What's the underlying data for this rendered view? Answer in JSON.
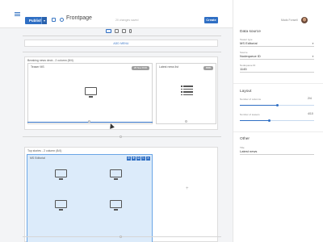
{
  "topbar": {
    "publish_label": "Publish",
    "page_name": "Frontpage",
    "changes_text": "20 changes saved",
    "create_label": "Create",
    "user_name": "Mads Fonsell"
  },
  "canvas": {
    "add_menu_label": "ADD MENU",
    "section1": {
      "label": "Breaking news deck - 2 column (8/4)",
      "module_a_label": "Teaser MS",
      "module_a_badge": "26 Nov 8:00",
      "module_b_label": "Latest news list",
      "module_b_badge": "BBB"
    },
    "section2": {
      "label": "Top stories - 2 column (8/4)",
      "module_label": "MS Editorial"
    }
  },
  "panel": {
    "data_source_title": "Data source",
    "teaser_type_label": "Teaser type",
    "teaser_type_value": "MS Editorial",
    "source_label": "Source",
    "source_value": "Nodequeue ID",
    "nodequeue_label": "Nodequeue ID",
    "nodequeue_value": "1145",
    "layout_title": "Layout",
    "columns_label": "Number of columns",
    "columns_value": "2/4",
    "columns_fraction": 0.5,
    "teasers_label": "Number of teasers",
    "teasers_value": "4/10",
    "teasers_fraction": 0.4,
    "other_title": "Other",
    "title_label": "Title",
    "title_value": "Latest news"
  },
  "colors": {
    "accent": "#2f6fc4",
    "selection": "#dcebfa"
  }
}
